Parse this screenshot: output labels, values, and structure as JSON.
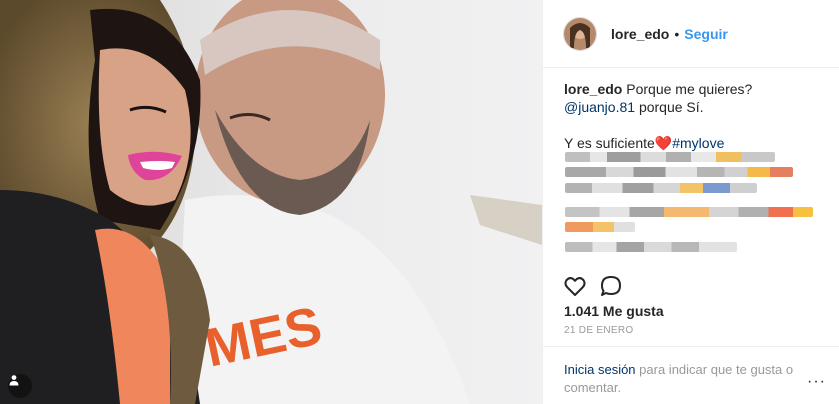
{
  "post": {
    "username": "lore_edo",
    "separator": "•",
    "follow_label": "Seguir",
    "caption": {
      "username": "lore_edo",
      "text_1": "Porque me quieres?",
      "mention": "@juanjo.81",
      "text_2": "porque Sí.",
      "text_3": "Y es suficiente",
      "heart": "❤️",
      "hashtag": "#mylove"
    },
    "likes": "1.041 Me gusta",
    "date": "21 DE ENERO",
    "login": {
      "link": "Inicia sesión",
      "text": "para indicar que te gusta o comentar."
    },
    "more_label": "···"
  },
  "icons": {
    "like": "heart-outline-icon",
    "comment": "comment-bubble-icon",
    "tag": "person-tag-icon",
    "more": "more-dots-icon"
  },
  "colors": {
    "link": "#3897f0",
    "dark_link": "#003569",
    "muted": "#999999",
    "text": "#262626"
  }
}
